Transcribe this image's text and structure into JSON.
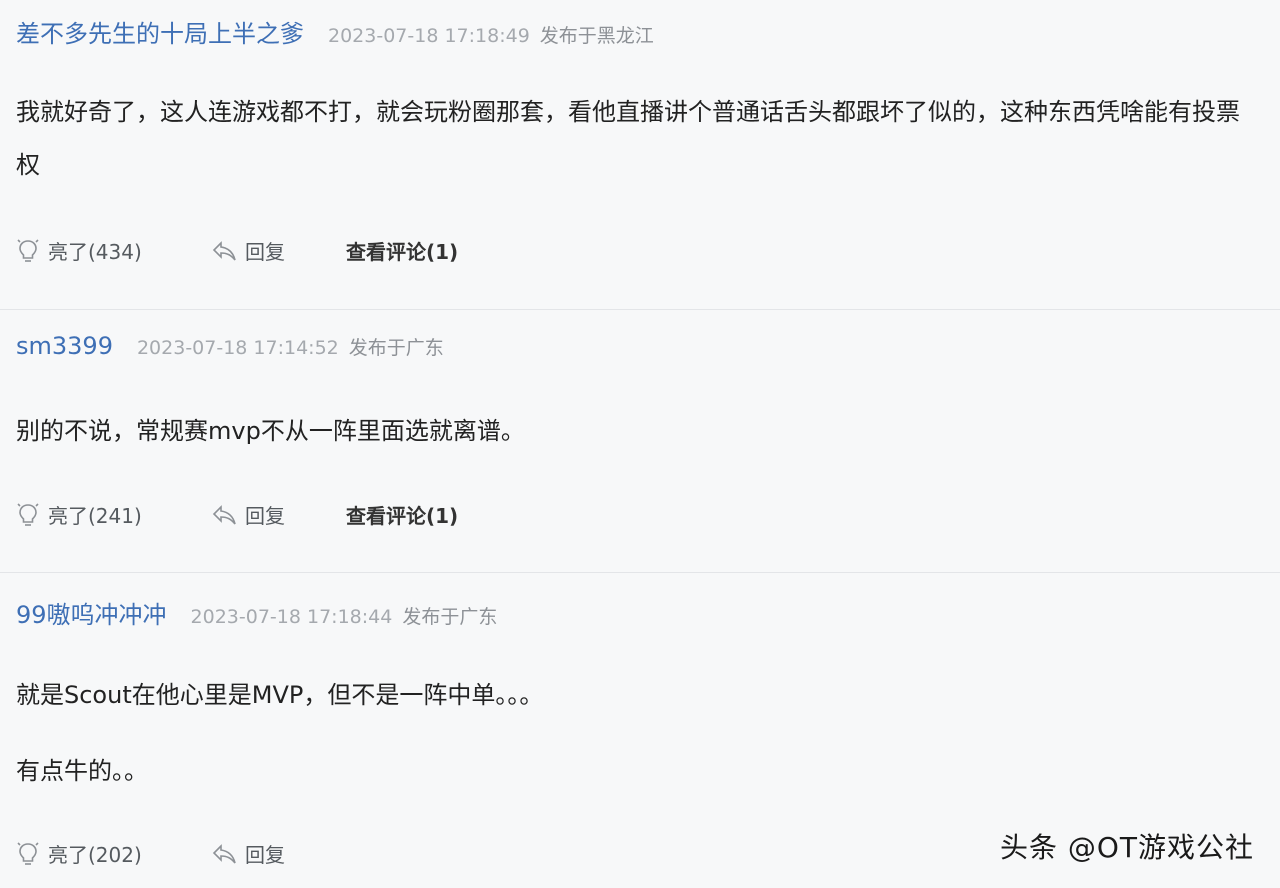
{
  "comments": [
    {
      "username": "差不多先生的十局上半之爹",
      "timestamp": "2023-07-18 17:18:49",
      "location": "发布于黑龙江",
      "paragraphs": [
        "我就好奇了，这人连游戏都不打，就会玩粉圈那套，看他直播讲个普通话舌头都跟坏了似的，这种东西凭啥能有投票权"
      ],
      "likes_label": "亮了(434)",
      "reply_label": "回复",
      "view_comments_label": "查看评论(1)"
    },
    {
      "username": "sm3399",
      "timestamp": "2023-07-18 17:14:52",
      "location": "发布于广东",
      "paragraphs": [
        "别的不说，常规赛mvp不从一阵里面选就离谱。"
      ],
      "likes_label": "亮了(241)",
      "reply_label": "回复",
      "view_comments_label": "查看评论(1)"
    },
    {
      "username": "99嗷呜冲冲冲",
      "timestamp": "2023-07-18 17:18:44",
      "location": "发布于广东",
      "paragraphs": [
        "就是Scout在他心里是MVP，但不是一阵中单。。。",
        "有点牛的。。"
      ],
      "likes_label": "亮了(202)",
      "reply_label": "回复"
    }
  ],
  "watermark": "头条 @OT游戏公社",
  "icons": {
    "like": "lightbulb-icon",
    "reply": "reply-arrow-icon"
  },
  "colors": {
    "username": "#3e6fb5",
    "background": "#f7f8f9",
    "divider": "#e3e5e8"
  }
}
